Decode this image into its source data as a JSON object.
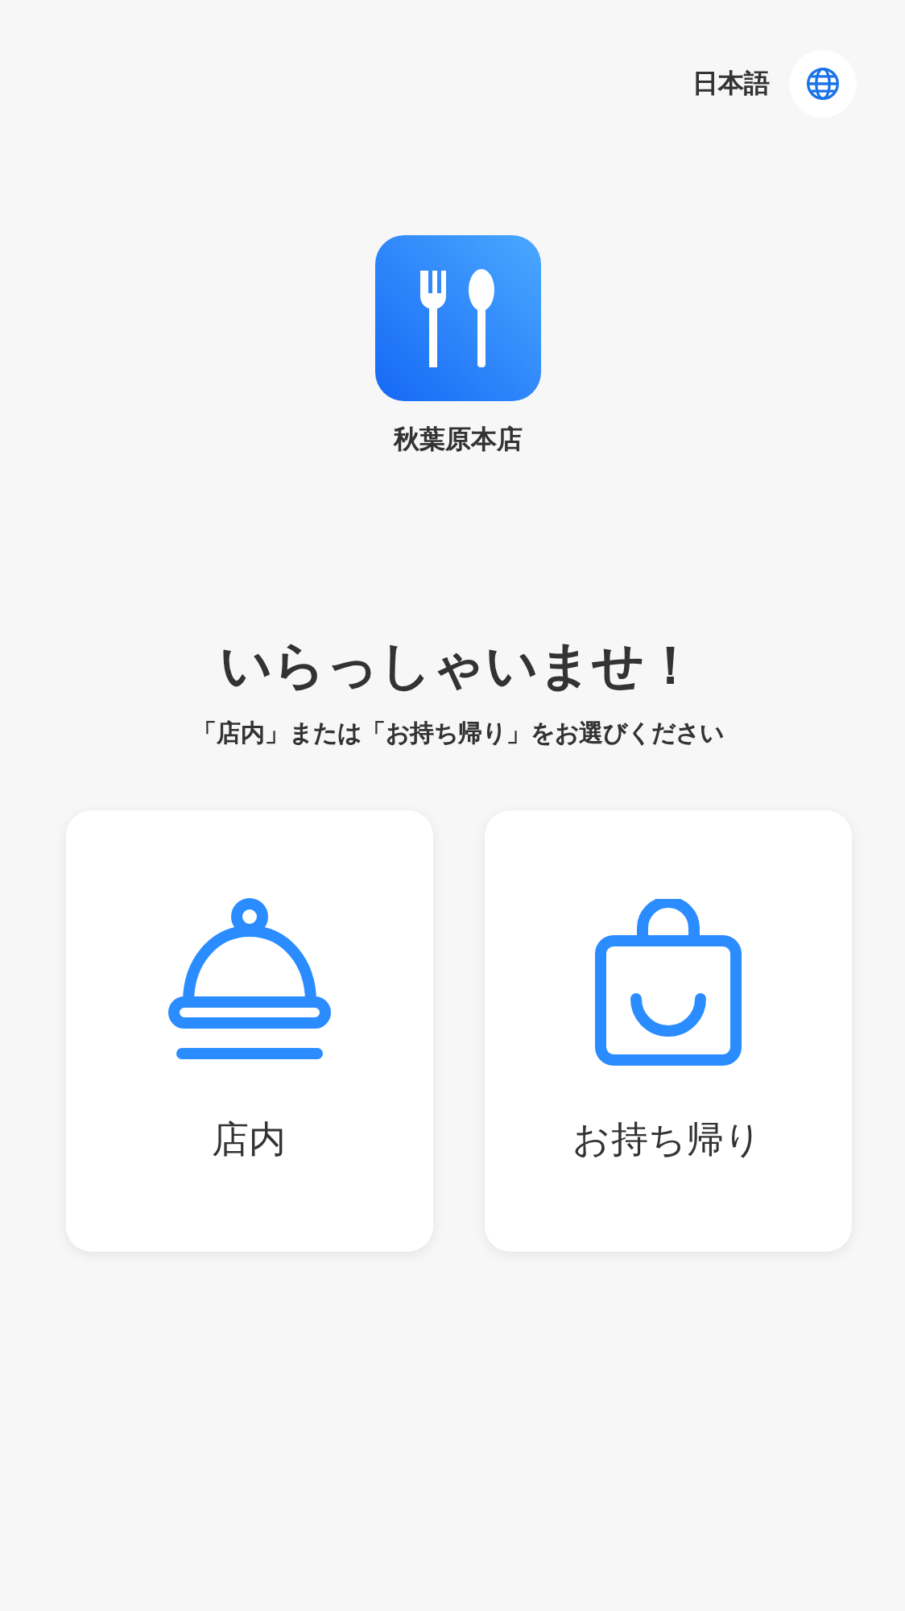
{
  "language": {
    "label": "日本語"
  },
  "store": {
    "name": "秋葉原本店"
  },
  "greeting": "いらっしゃいませ！",
  "instruction": "「店内」または「お持ち帰り」をお選びください",
  "options": [
    {
      "kind": "dine_in",
      "label": "店内"
    },
    {
      "kind": "takeout",
      "label": "お持ち帰り"
    }
  ]
}
